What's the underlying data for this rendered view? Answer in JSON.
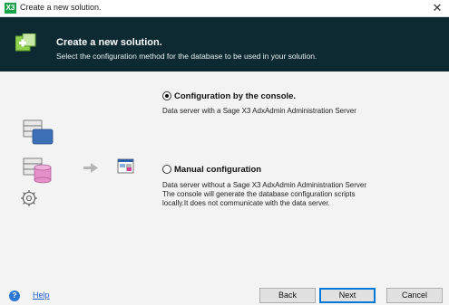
{
  "window": {
    "title": "Create a new solution.",
    "app_icon": "X3"
  },
  "header": {
    "title": "Create a new solution.",
    "subtitle": "Select the configuration method for the database to be used in your solution."
  },
  "options": [
    {
      "label": "Configuration by the console.",
      "selected": true,
      "description": [
        "Data server with a Sage X3 AdxAdmin Administration Server"
      ]
    },
    {
      "label": "Manual configuration",
      "selected": false,
      "description": [
        "Data server without a Sage X3 AdxAdmin Administration Server",
        "The console will generate the database configuration scripts",
        "locally.It does not communicate with the data server."
      ]
    }
  ],
  "footer": {
    "help": "Help",
    "help_icon": "?",
    "back": "Back",
    "next": "Next",
    "cancel": "Cancel"
  },
  "icons": [
    "x3-app-icon",
    "close-icon",
    "solution-wizard-icon",
    "server-icon",
    "database-server-icon",
    "arrow-right-icon",
    "console-window-icon",
    "gear-icon",
    "help-icon"
  ],
  "colors": {
    "header_bg": "#0d2a33",
    "app_icon": "#18a34a",
    "primary_border": "#0078d7",
    "link": "#1f5fd1"
  }
}
